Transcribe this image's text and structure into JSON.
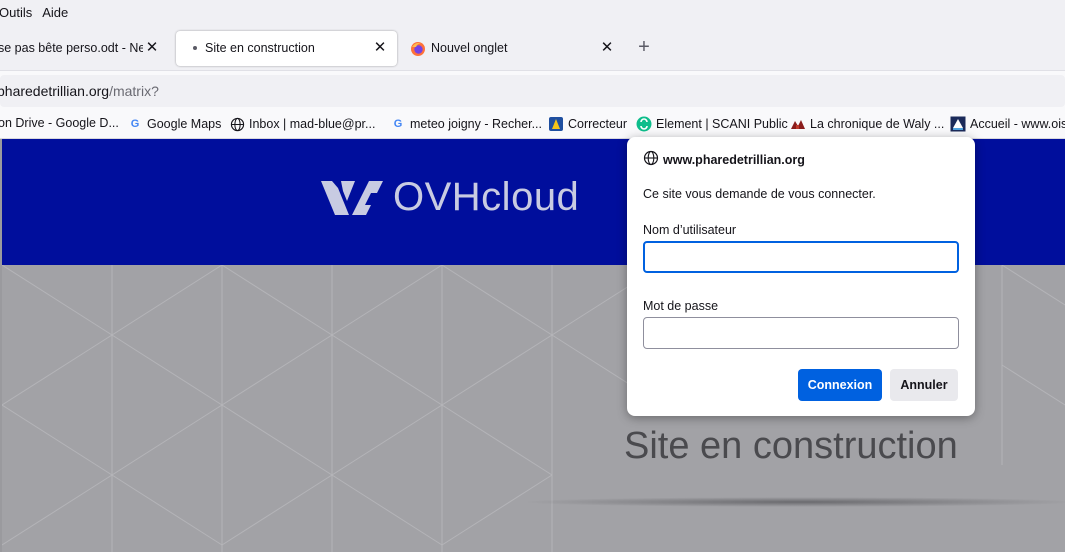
{
  "menu": {
    "items": [
      "Outils",
      "Aide"
    ]
  },
  "tabs": [
    {
      "title": "se pas bête perso.odt - Next",
      "close": "✕"
    },
    {
      "title": "Site en construction",
      "close": "✕"
    },
    {
      "title": "Nouvel onglet",
      "close": "✕"
    }
  ],
  "new_tab": "+",
  "urlbar": {
    "host": "pharedetrillian.org",
    "path": "/matrix?"
  },
  "bookmarks": [
    {
      "label": "on Drive - Google D...",
      "icon": "drive-icon"
    },
    {
      "label": "Google Maps",
      "icon": "google-icon"
    },
    {
      "label": "Inbox | mad-blue@pr...",
      "icon": "globe-icon"
    },
    {
      "label": "meteo joigny - Recher...",
      "icon": "google-icon"
    },
    {
      "label": "Correcteur",
      "icon": "correcteur-icon"
    },
    {
      "label": "Element | SCANI Public",
      "icon": "element-icon"
    },
    {
      "label": "La chronique de Waly ...",
      "icon": "chronique-icon"
    },
    {
      "label": "Accueil - www.oise",
      "icon": "lrb-icon"
    }
  ],
  "page": {
    "brand": "OVHcloud",
    "heading": "Site en construction"
  },
  "dialog": {
    "host": "www.pharedetrillian.org",
    "message": "Ce site vous demande de vous connecter.",
    "username_label": "Nom d’utilisateur",
    "username_value": "",
    "password_label": "Mot de passe",
    "password_value": "",
    "login_button": "Connexion",
    "cancel_button": "Annuler"
  },
  "colors": {
    "ovh_blue": "#000e9c",
    "accent": "#0061e0"
  }
}
